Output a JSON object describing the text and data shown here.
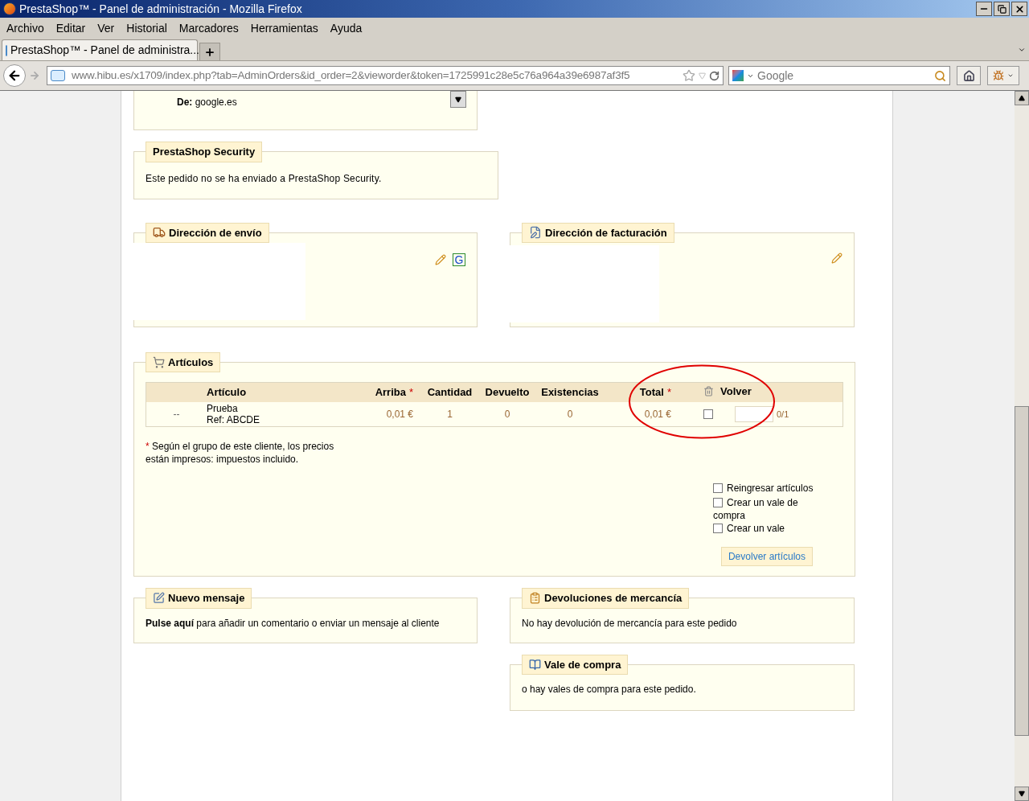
{
  "window": {
    "title": "PrestaShop™ - Panel de administración - Mozilla Firefox"
  },
  "menu": {
    "items": [
      "Archivo",
      "Editar",
      "Ver",
      "Historial",
      "Marcadores",
      "Herramientas",
      "Ayuda"
    ]
  },
  "tabs": [
    {
      "label": "PrestaShop™ - Panel de administra...",
      "selected": true
    }
  ],
  "address_bar": {
    "url": "www.hibu.es/x1709/index.php?tab=AdminOrders&id_order=2&vieworder&token=1725991c28e5c76a964a39e6987af3f5"
  },
  "search": {
    "placeholder": "Google"
  },
  "referrer": {
    "label": "De:",
    "value": "google.es"
  },
  "security": {
    "title": "PrestaShop Security",
    "text": "Este pedido no se ha enviado a PrestaShop Security."
  },
  "shipping": {
    "title": "Dirección de envío",
    "map_link": "G"
  },
  "billing": {
    "title": "Dirección de facturación"
  },
  "articles": {
    "title": "Artículos",
    "columns": [
      {},
      {
        "label": "Artículo"
      },
      {
        "label": "Arriba",
        "mark": "*"
      },
      {
        "label": "Cantidad"
      },
      {
        "label": "Devuelto"
      },
      {
        "label": "Existencias"
      },
      {
        "label": "Total",
        "mark": "*"
      },
      {
        "label": "Volver"
      }
    ],
    "rows": [
      {
        "column_1": "--",
        "name": "Prueba",
        "ref": "Ref: ABCDE",
        "price": "0,01 €",
        "quantity": "1",
        "returned": "0",
        "stock": "0",
        "total": "0,01 €",
        "checked": false,
        "return_quantity": "",
        "max": "0/1"
      }
    ],
    "note": {
      "mark": "*",
      "text": "Según el grupo de este cliente, los precios están impresos: impuestos incluido."
    },
    "options": [
      {
        "label": "Reingresar artículos",
        "checked": false
      },
      {
        "label": "Crear un vale de compra",
        "checked": false
      },
      {
        "label": "Crear un vale",
        "checked": false
      }
    ],
    "button": "Devolver artículos"
  },
  "message": {
    "title": "Nuevo mensaje",
    "text": "**Pulse aquí** para añadir un comentario o enviar un mensaje al cliente"
  },
  "returns": {
    "title": "Devoluciones de mercancía",
    "text": "No hay devolución de mercancía para este pedido"
  },
  "vouchers": {
    "title": "Vale de compra",
    "text": "o hay vales de compra para este pedido."
  }
}
